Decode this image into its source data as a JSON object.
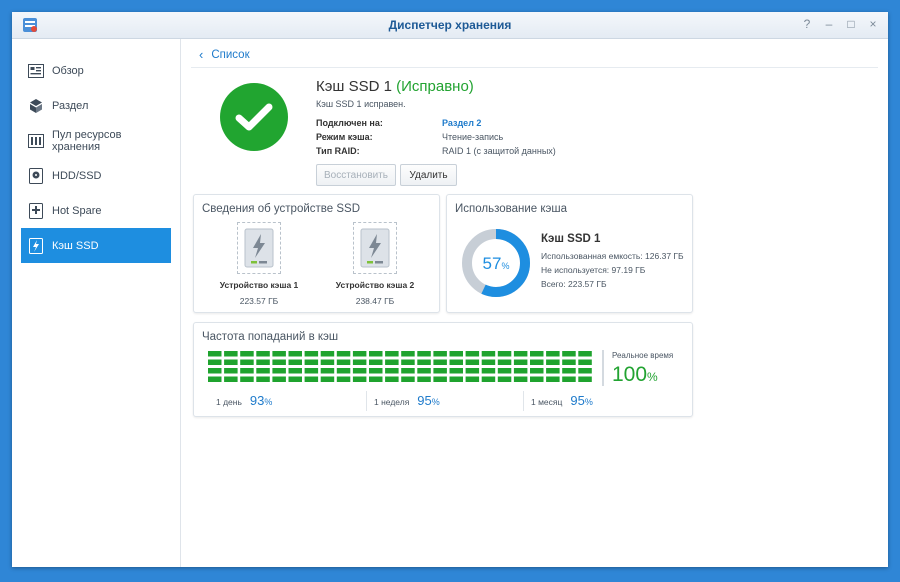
{
  "window": {
    "title": "Диспетчер хранения",
    "controls": [
      "?",
      "–",
      "□",
      "×"
    ]
  },
  "sidebar": {
    "items": [
      {
        "label": "Обзор",
        "icon": "overview-icon"
      },
      {
        "label": "Раздел",
        "icon": "volume-icon"
      },
      {
        "label": "Пул ресурсов хранения",
        "icon": "storage-pool-icon"
      },
      {
        "label": "HDD/SSD",
        "icon": "disk-icon"
      },
      {
        "label": "Hot Spare",
        "icon": "hot-spare-icon"
      },
      {
        "label": "Кэш SSD",
        "icon": "ssd-cache-icon",
        "active": true
      }
    ]
  },
  "breadcrumb": {
    "label": "Список"
  },
  "summary": {
    "title": "Кэш SSD 1",
    "status": "(Исправно)",
    "subtitle": "Кэш SSD 1 исправен.",
    "props": [
      {
        "label": "Подключен на:",
        "value": "Раздел 2",
        "link": true
      },
      {
        "label": "Режим кэша:",
        "value": "Чтение-запись",
        "link": false
      },
      {
        "label": "Тип RAID:",
        "value": "RAID 1 (с защитой данных)",
        "link": false
      }
    ],
    "buttons": {
      "restore": "Восстановить",
      "delete": "Удалить"
    }
  },
  "devices_panel": {
    "title": "Сведения об устройстве SSD",
    "devices": [
      {
        "name": "Устройство кэша 1",
        "size": "223.57 ГБ"
      },
      {
        "name": "Устройство кэша 2",
        "size": "238.47 ГБ"
      }
    ]
  },
  "usage_panel": {
    "title": "Использование кэша",
    "percent": "57",
    "percent_unit": "%",
    "name": "Кэш SSD 1",
    "used": "Использованная емкость: 126.37 ГБ",
    "free": "Не используется: 97.19 ГБ",
    "total": "Всего: 223.57 ГБ"
  },
  "hit_panel": {
    "title": "Частота попаданий в кэш",
    "stats": [
      {
        "label": "1 день",
        "value": "93",
        "unit": "%"
      },
      {
        "label": "1 неделя",
        "value": "95",
        "unit": "%"
      },
      {
        "label": "1 месяц",
        "value": "95",
        "unit": "%"
      }
    ],
    "realtime_label": "Реальное время",
    "realtime_value": "100",
    "realtime_unit": "%"
  },
  "colors": {
    "accent": "#1e8ee0",
    "ok": "#22a331",
    "donut_bg": "#c7ced6",
    "grid": "#1fa32e"
  }
}
